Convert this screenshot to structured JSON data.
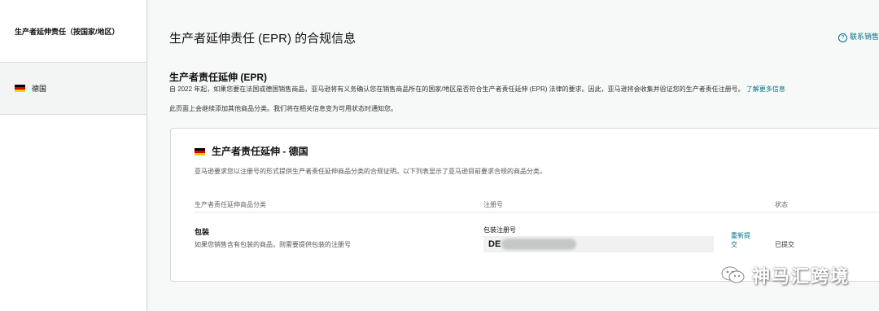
{
  "sidebar": {
    "header": "生产者延伸责任（按国家/地区）",
    "items": [
      {
        "label": "德国",
        "flag": "germany-flag"
      }
    ]
  },
  "header": {
    "title": "生产者延伸责任 (EPR) 的合规信息",
    "contact_link": "联系销售"
  },
  "epr_section": {
    "title": "生产者责任延伸 (EPR)",
    "description_line1": "自 2022 年起，如果您要在法国或德国销售商品，亚马逊将有义务确认您在销售商品所在的国家/地区是否符合生产者责任延伸 (EPR) 法律的要求。因此，亚马逊将会收集并验证您的生产者责任注册号。",
    "learn_more": "了解更多信息",
    "description_line2": "此页面上会继续添加其他商品分类。我们将在相关信息变为可用状态时通知您。"
  },
  "card": {
    "title": "生产者责任延伸 - 德国",
    "description": "亚马逊要求您以注册号的形式提供生产者责任延伸商品分类的合规证明。以下列表显示了亚马逊目前要求合规的商品分类。",
    "columns": {
      "category": "生产者责任延伸商品分类",
      "registration": "注册号",
      "status": "状态"
    },
    "rows": [
      {
        "category": "包装",
        "category_desc": "如果您销售含有包装的商品，则需要提供包装的注册号",
        "reg_label": "包装注册号",
        "reg_value": "DE",
        "action": "重新提交",
        "status": "已提交"
      }
    ]
  },
  "watermark": {
    "text": "神马汇跨境",
    "icon": "wechat-icon"
  },
  "colors": {
    "link": "#007185",
    "background": "#f0f2f2"
  }
}
